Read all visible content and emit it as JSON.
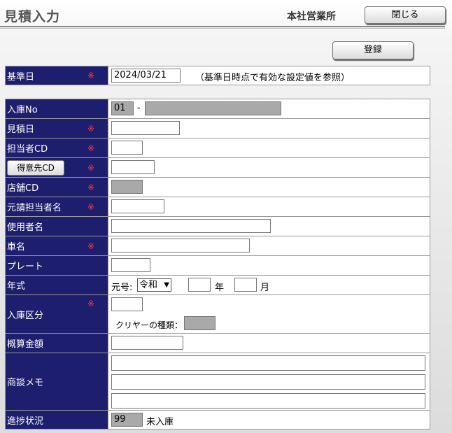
{
  "header": {
    "title": "見積入力",
    "office": "本社営業所",
    "close_label": "閉じる"
  },
  "toolbar": {
    "register_label": "登録"
  },
  "required_mark": "※",
  "base_date": {
    "label": "基準日",
    "value": "2024/03/21",
    "note": "（基準日時点で有効な設定値を参照）"
  },
  "fields": {
    "entry_no": {
      "label": "入庫No",
      "prefix": "01",
      "separator": "-",
      "value": ""
    },
    "estimate_date": {
      "label": "見積日",
      "value": ""
    },
    "staff_cd": {
      "label": "担当者CD",
      "value": ""
    },
    "customer_cd": {
      "label": "得意先CD",
      "value": ""
    },
    "store_cd": {
      "label": "店舗CD",
      "value": ""
    },
    "contractor_staff": {
      "label": "元請担当者名",
      "value": ""
    },
    "user_name": {
      "label": "使用者名",
      "value": ""
    },
    "car_name": {
      "label": "車名",
      "value": ""
    },
    "plate": {
      "label": "プレート",
      "value": ""
    },
    "model_year": {
      "label": "年式",
      "era_label": "元号:",
      "era_value": "令和",
      "year_value": "",
      "year_unit": "年",
      "month_value": "",
      "month_unit": "月"
    },
    "entry_category": {
      "label": "入庫区分",
      "value": "",
      "clear_type_label": "クリヤーの種類：",
      "clear_type_value": ""
    },
    "estimated_amount": {
      "label": "概算金額",
      "value": ""
    },
    "negotiation_memo": {
      "label": "商談メモ",
      "lines": [
        "",
        "",
        ""
      ]
    },
    "progress": {
      "label": "進捗状況",
      "code": "99",
      "status_text": "未入庫"
    }
  }
}
